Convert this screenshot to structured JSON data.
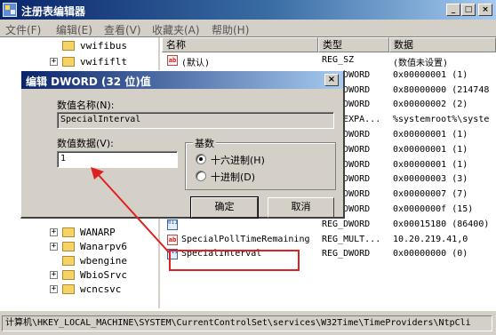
{
  "window": {
    "title": "注册表编辑器",
    "min_label": "_",
    "max_label": "□",
    "close_label": "×"
  },
  "menu": [
    "文件(F)",
    "编辑(E)",
    "查看(V)",
    "收藏夹(A)",
    "帮助(H)"
  ],
  "tree": {
    "items": [
      {
        "label": "vwifibus",
        "expandable": false
      },
      {
        "label": "vwififlt",
        "expandable": true
      },
      {
        "label": "WANARP",
        "expandable": true
      },
      {
        "label": "Wanarpv6",
        "expandable": true
      },
      {
        "label": "wbengine",
        "expandable": false
      },
      {
        "label": "WbioSrvc",
        "expandable": true
      },
      {
        "label": "wcncsvc",
        "expandable": true
      }
    ],
    "plus_glyph": "+"
  },
  "list": {
    "headers": {
      "name": "名称",
      "type": "类型",
      "data": "数据"
    },
    "rows": [
      {
        "name": "(默认)",
        "type": "REG_SZ",
        "data": "(数值未设置)",
        "icon": "string-value-icon",
        "icon_glyph": "ab"
      },
      {
        "name": "",
        "type": "REG_DWORD",
        "data": "0x00000001 (1)",
        "icon": "binary-value-icon",
        "icon_glyph": "011"
      },
      {
        "name": "",
        "type": "REG_DWORD",
        "data": "0x80000000 (214748",
        "icon": "binary-value-icon",
        "icon_glyph": "011"
      },
      {
        "name": "",
        "type": "REG_DWORD",
        "data": "0x00000002 (2)",
        "icon": "binary-value-icon",
        "icon_glyph": "011"
      },
      {
        "name": "",
        "type": "REG_EXPA...",
        "data": "%systemroot%\\syste",
        "icon": "string-value-icon",
        "icon_glyph": "ab"
      },
      {
        "name": "",
        "type": "REG_DWORD",
        "data": "0x00000001 (1)",
        "icon": "binary-value-icon",
        "icon_glyph": "011"
      },
      {
        "name": "",
        "type": "REG_DWORD",
        "data": "0x00000001 (1)",
        "icon": "binary-value-icon",
        "icon_glyph": "011"
      },
      {
        "name": "",
        "type": "REG_DWORD",
        "data": "0x00000001 (1)",
        "icon": "binary-value-icon",
        "icon_glyph": "011"
      },
      {
        "name": "",
        "type": "REG_DWORD",
        "data": "0x00000003 (3)",
        "icon": "binary-value-icon",
        "icon_glyph": "011"
      },
      {
        "name": "",
        "type": "REG_DWORD",
        "data": "0x00000007 (7)",
        "icon": "binary-value-icon",
        "icon_glyph": "011"
      },
      {
        "name": "",
        "type": "REG_DWORD",
        "data": "0x0000000f (15)",
        "icon": "binary-value-icon",
        "icon_glyph": "011"
      },
      {
        "name": "",
        "type": "REG_DWORD",
        "data": "0x00015180 (86400)",
        "icon": "binary-value-icon",
        "icon_glyph": "011"
      },
      {
        "name": "SpecialPollTimeRemaining",
        "type": "REG_MULT...",
        "data": "10.20.219.41,0",
        "icon": "string-value-icon",
        "icon_glyph": "ab"
      },
      {
        "name": "SpecialInterval",
        "type": "REG_DWORD",
        "data": "0x00000000 (0)",
        "icon": "binary-value-icon",
        "icon_glyph": "011"
      }
    ]
  },
  "status": "计算机\\HKEY_LOCAL_MACHINE\\SYSTEM\\CurrentControlSet\\services\\W32Time\\TimeProviders\\NtpCli",
  "dialog": {
    "title": "编辑 DWORD (32 位)值",
    "close_label": "×",
    "name_label": "数值名称(N):",
    "name_value": "SpecialInterval",
    "data_label": "数值数据(V):",
    "data_value": "1",
    "base_label": "基数",
    "base_options": [
      "十六进制(H)",
      "十进制(D)"
    ],
    "base_selected": "十六进制(H)",
    "ok_label": "确定",
    "cancel_label": "取消"
  },
  "annotation_color": "#e02020"
}
